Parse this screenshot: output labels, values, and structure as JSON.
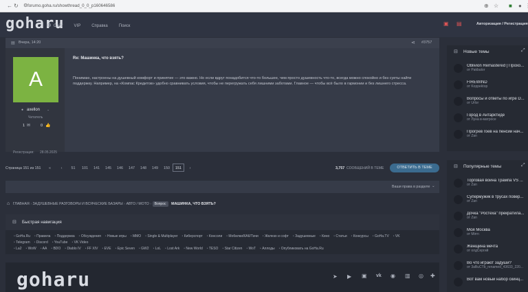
{
  "browser": {
    "url": "forumo.goha.ru/showthread_0_0_p160646586"
  },
  "header": {
    "logo": "goharu",
    "nav": [
      "Сайт",
      "VIP",
      "Справка",
      "Поиск"
    ],
    "auth": "Авторизация / Регистрация"
  },
  "post": {
    "date": "Вчера, 14:20",
    "number": "#3757",
    "avatar_letter": "A",
    "avatar_color": "#7cb342",
    "username": "axellon",
    "role": "Читатель",
    "reactions": "1",
    "likes": "0",
    "reg_label": "Регистрация:",
    "reg_date": "28.05.2025",
    "title": "Re: Машинка, что взять?",
    "body": "Понимаю, настроены на душевный комфорт и принятие — это важно. Но если вдруг понадобится что-то большее, чем просто душевность что-то, всегда можно спокойно и без суеты найти поддержку. Например, на «Компас Кредитов» удобно сравнивать условия, чтобы не перегружать себя лишними заботами. Главное — чтобы всё было в гармонии и без лишнего стресса."
  },
  "pagination": {
    "label": "Страница 151 из 151",
    "pages": [
      "«",
      "‹",
      "51",
      "101",
      "141",
      "145",
      "146",
      "147",
      "148",
      "149",
      "150",
      "151",
      "›"
    ],
    "current": "151",
    "messages": "3,757",
    "messages_label": "СООБЩЕНИЙ В ТЕМЕ",
    "reply": "ОТВЕТИТЬ В ТЕМЕ"
  },
  "rights": "Ваши права в разделе",
  "breadcrumb": {
    "items": [
      "ГЛАВНАЯ",
      "ЗАДУШЕВНЫЕ РАЗГОВОРЫ И ВСЯЧЕСКИЕ БАЗАРЫ",
      "АВТО / МОТО"
    ],
    "tag": "Вопрос",
    "current": "МАШИНКА, ЧТО ВЗЯТЬ?"
  },
  "quicknav": {
    "title": "Быстрая навигация",
    "row1": [
      "GoHa.Ru",
      "Правила",
      "Поддержка",
      "Обсуждения",
      "Новые игры",
      "MMO",
      "Single & Multiplayer",
      "Киберспорт",
      "Консоли",
      "Мобилки/КАК/Тачи",
      "Железо и софт",
      "Задушевные",
      "Кино",
      "Статьи",
      "Конкурсы",
      "GoHa.TV",
      "VK"
    ],
    "row2": [
      "Telegram",
      "Discord",
      "YouTube",
      "VK Video"
    ],
    "row3": [
      "La2",
      "WoW",
      "AA",
      "BDO",
      "Diablo IV",
      "FF XIV",
      "EVE",
      "Epic Seven",
      "GW2",
      "LoL",
      "Lost Ark",
      "New World",
      "TESO",
      "Star Citizen",
      "WoT",
      "Аллоды",
      "Опубликовать на GoHa.Ru"
    ]
  },
  "footer": {
    "logo": "goharu"
  },
  "sidebar": {
    "new_title": "Новые темы",
    "new_items": [
      {
        "title": "Oblivion Remastered | Прохо...",
        "sub": "от Pakbutor"
      },
      {
        "title": "FIREWIND",
        "sub": "от Koppektop"
      },
      {
        "title": "Вопросы и ответы по игре D...",
        "sub": "от Urlor"
      },
      {
        "title": "Город в Антарктиде",
        "sub": "от Луна в-матросе"
      },
      {
        "title": "Прогрев гоев на пенсии нач...",
        "sub": "от Zan"
      }
    ],
    "pop_title": "Популярные темы",
    "pop_items": [
      {
        "title": "Торговая война Трампа VS ...",
        "sub": "от Zan"
      },
      {
        "title": "Супермужик в трусах повер...",
        "sub": "от Zan"
      },
      {
        "title": "Дочка \"Ростеха\" прекратила...",
        "sub": "от Zan"
      },
      {
        "title": "Моя Москва",
        "sub": "от Mirrn"
      },
      {
        "title": "Женщина мечта",
        "sub": "от олдСергий"
      },
      {
        "title": "Во что играют задуши?",
        "sub": "от 3aBuCTb_renamed_43633_220..."
      },
      {
        "title": "Вот вам новый набор скинц...",
        "sub": ""
      }
    ]
  },
  "colors": {
    "accent": "#3b6b8f",
    "bg": "#2b2f3a"
  }
}
